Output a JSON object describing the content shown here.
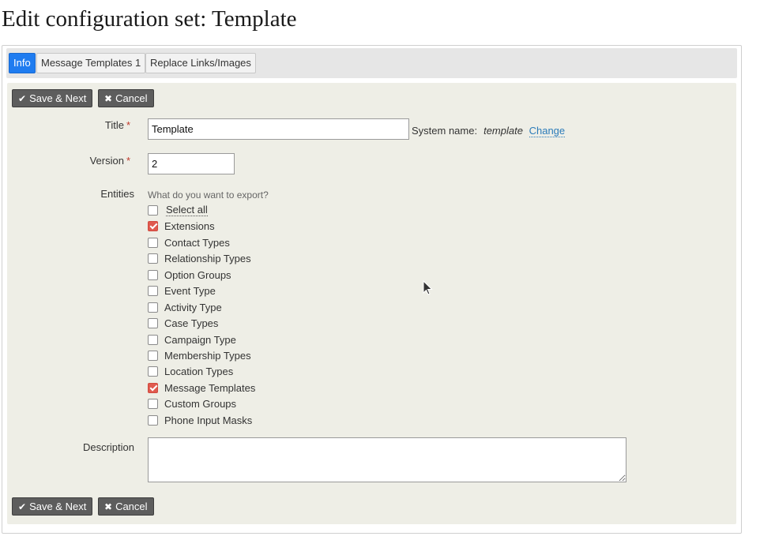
{
  "page": {
    "title": "Edit configuration set: Template"
  },
  "tabs": [
    {
      "label": "Info",
      "active": true
    },
    {
      "label": "Message Templates 1",
      "active": false
    },
    {
      "label": "Replace Links/Images",
      "active": false
    }
  ],
  "buttons": {
    "save_next": "Save & Next",
    "cancel": "Cancel"
  },
  "form": {
    "title": {
      "label": "Title",
      "required_mark": "*",
      "value": "Template"
    },
    "system_name": {
      "label": "System name:",
      "value": "template",
      "change_link": "Change"
    },
    "version": {
      "label": "Version",
      "required_mark": "*",
      "value": "2"
    },
    "entities": {
      "label": "Entities",
      "help": "What do you want to export?",
      "select_all": "Select all",
      "items": [
        {
          "label": "Extensions",
          "checked": true
        },
        {
          "label": "Contact Types",
          "checked": false
        },
        {
          "label": "Relationship Types",
          "checked": false
        },
        {
          "label": "Option Groups",
          "checked": false
        },
        {
          "label": "Event Type",
          "checked": false
        },
        {
          "label": "Activity Type",
          "checked": false
        },
        {
          "label": "Case Types",
          "checked": false
        },
        {
          "label": "Campaign Type",
          "checked": false
        },
        {
          "label": "Membership Types",
          "checked": false
        },
        {
          "label": "Location Types",
          "checked": false
        },
        {
          "label": "Message Templates",
          "checked": true
        },
        {
          "label": "Custom Groups",
          "checked": false
        },
        {
          "label": "Phone Input Masks",
          "checked": false
        }
      ]
    },
    "description": {
      "label": "Description",
      "value": ""
    }
  },
  "colors": {
    "active_tab": "#1f7cf0",
    "checkbox_checked": "#e05a4f",
    "link": "#2b7bb9",
    "content_bg": "#eeeee6",
    "button_bg": "#5d5d5d"
  }
}
